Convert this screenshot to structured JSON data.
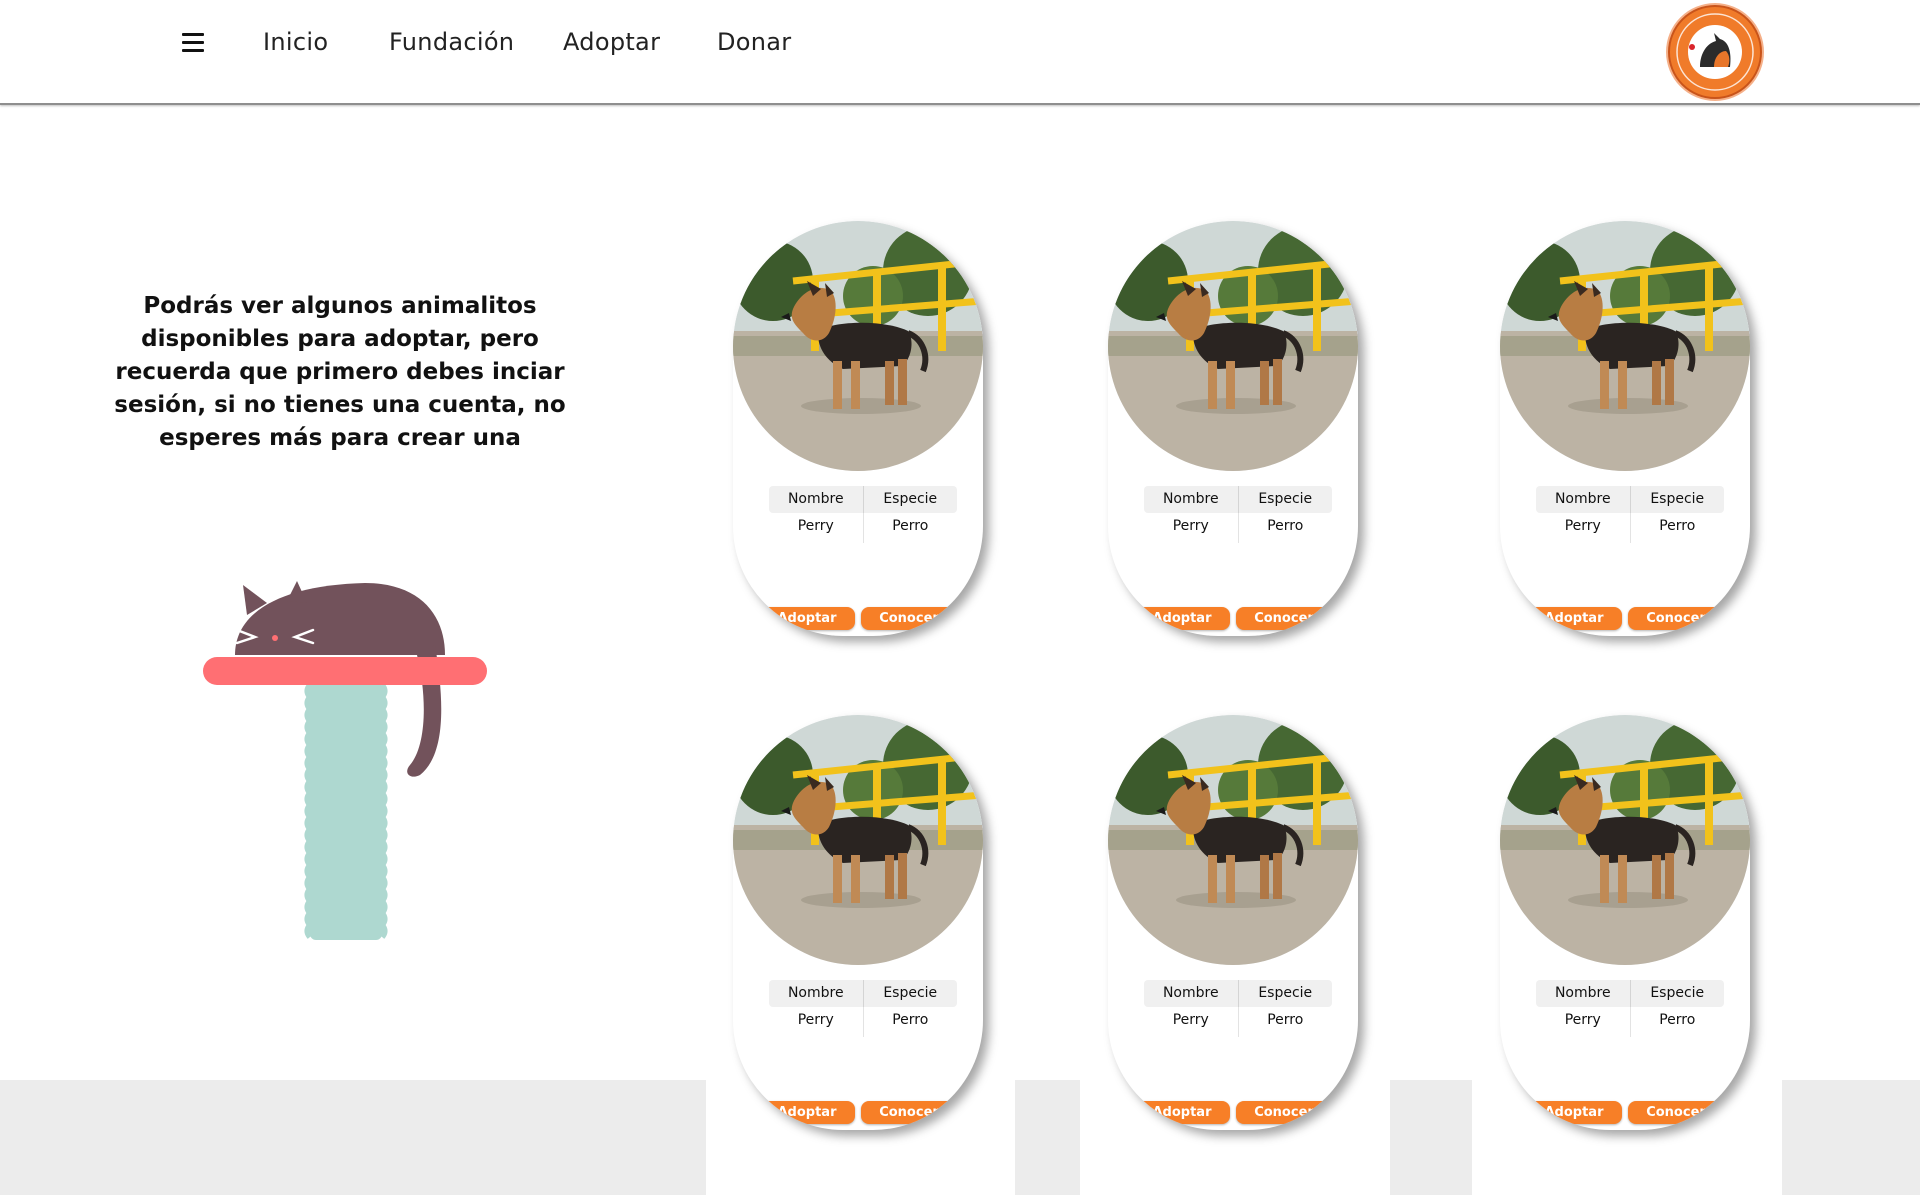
{
  "nav": {
    "items": [
      {
        "label": "Inicio"
      },
      {
        "label": "Fundación"
      },
      {
        "label": "Adoptar"
      },
      {
        "label": "Donar"
      }
    ]
  },
  "intro": {
    "text": "Podrás ver algunos animalitos disponibles para adoptar, pero recuerda que primero debes inciar sesión, si no tienes una cuenta, no esperes más para crear una"
  },
  "table_headers": {
    "name": "Nombre",
    "species": "Especie"
  },
  "cards": [
    {
      "name": "Perry",
      "species": "Perro",
      "adopt_label": "Adoptar",
      "meet_label": "Conocer"
    },
    {
      "name": "Perry",
      "species": "Perro",
      "adopt_label": "Adoptar",
      "meet_label": "Conocer"
    },
    {
      "name": "Perry",
      "species": "Perro",
      "adopt_label": "Adoptar",
      "meet_label": "Conocer"
    },
    {
      "name": "Perry",
      "species": "Perro",
      "adopt_label": "Adoptar",
      "meet_label": "Conocer"
    },
    {
      "name": "Perry",
      "species": "Perro",
      "adopt_label": "Adoptar",
      "meet_label": "Conocer"
    },
    {
      "name": "Perry",
      "species": "Perro",
      "adopt_label": "Adoptar",
      "meet_label": "Conocer"
    }
  ],
  "colors": {
    "accent": "#f77f27",
    "cat_body": "#72525b",
    "perch": "#ff6f73",
    "post": "#aed8d0",
    "footer_gray": "#ececec"
  },
  "icons": {
    "menu": "hamburger-icon",
    "logo": "foundation-logo"
  }
}
